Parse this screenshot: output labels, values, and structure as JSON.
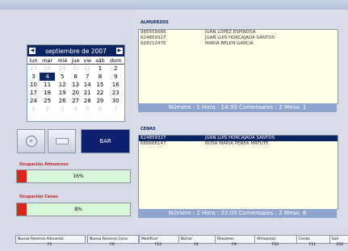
{
  "calendar": {
    "month_label": "septiembre de 2007",
    "weekdays": [
      "lun",
      "mar",
      "mié",
      "jue",
      "vie",
      "sáb",
      "dom"
    ],
    "weeks": [
      [
        {
          "d": "27",
          "o": true
        },
        {
          "d": "28",
          "o": true
        },
        {
          "d": "29",
          "o": true
        },
        {
          "d": "30",
          "o": true
        },
        {
          "d": "31",
          "o": true
        },
        {
          "d": "1"
        },
        {
          "d": "2"
        }
      ],
      [
        {
          "d": "3"
        },
        {
          "d": "4",
          "s": true
        },
        {
          "d": "5"
        },
        {
          "d": "6"
        },
        {
          "d": "7"
        },
        {
          "d": "8"
        },
        {
          "d": "9"
        }
      ],
      [
        {
          "d": "10"
        },
        {
          "d": "11"
        },
        {
          "d": "12"
        },
        {
          "d": "13"
        },
        {
          "d": "14"
        },
        {
          "d": "15"
        },
        {
          "d": "16"
        }
      ],
      [
        {
          "d": "17"
        },
        {
          "d": "18"
        },
        {
          "d": "19"
        },
        {
          "d": "20"
        },
        {
          "d": "21"
        },
        {
          "d": "22"
        },
        {
          "d": "23"
        }
      ],
      [
        {
          "d": "24"
        },
        {
          "d": "25"
        },
        {
          "d": "26"
        },
        {
          "d": "27"
        },
        {
          "d": "28"
        },
        {
          "d": "29"
        },
        {
          "d": "30"
        }
      ],
      [
        {
          "d": "1",
          "o": true
        },
        {
          "d": "2",
          "o": true
        },
        {
          "d": "3",
          "o": true
        },
        {
          "d": "4",
          "o": true
        },
        {
          "d": "5",
          "o": true
        },
        {
          "d": "6",
          "o": true
        },
        {
          "d": "7",
          "o": true
        }
      ]
    ]
  },
  "buttons": {
    "bar_label": "BAR"
  },
  "occupancy": {
    "lunch_label": "Ocupación Almuerzos",
    "lunch_value": "16%",
    "dinner_label": "Ocupación Cenas",
    "dinner_value": "8%",
    "fill_color": "#d9251c"
  },
  "lunch": {
    "title": "ALMUERZOS",
    "rows": [
      {
        "phone": "985555666",
        "name": "JUAN LOPEZ ESPINOSA"
      },
      {
        "phone": "624859327",
        "name": "JUAN LUIS HORCAJADA SANTOS"
      },
      {
        "phone": "628212476",
        "name": "MARIA BELEN GARCIA"
      }
    ],
    "summary": "Número : 1  Hora : 14:30  Comensales : 2  Mesa: 1"
  },
  "dinner": {
    "title": "CENAS",
    "rows": [
      {
        "phone": "624859327",
        "name": "JUAN LUIS HORCAJADA SANTOS",
        "selected": true
      },
      {
        "phone": "666666147",
        "name": "ROSA MARIA PEREA MATUTE"
      }
    ],
    "summary": "Número : 2  Hora : 22:00  Comensales : 2  Mesa: 6"
  },
  "footer": [
    {
      "label": "Nueva Reserva Almuerzo",
      "key": "F5"
    },
    {
      "label": "Nueva Reserva Cena",
      "key": "F6"
    },
    {
      "label": "Modificar",
      "key": "F12"
    },
    {
      "label": "Borrar",
      "key": "F4"
    },
    {
      "label": "Resumen",
      "key": "F9"
    },
    {
      "label": "Almuerzos",
      "key": "F10"
    },
    {
      "label": "Cenas",
      "key": "F11"
    },
    {
      "label": "Sali",
      "key": "ESC"
    }
  ]
}
